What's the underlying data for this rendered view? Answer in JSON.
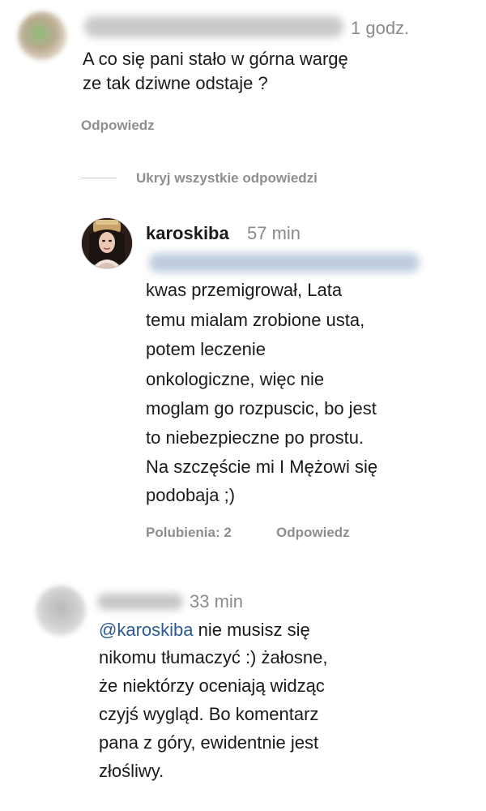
{
  "comments": [
    {
      "time": "1 godz.",
      "text_lines": [
        "A co się pani stało w górna wargę",
        "ze tak dziwne odstaje ?"
      ],
      "reply_label": "Odpowiedz"
    },
    {
      "hide_replies_label": "Ukryj wszystkie odpowiedzi"
    },
    {
      "username": "karoskiba",
      "time": "57 min",
      "text_lines": [
        "kwas przemigrował, Lata",
        "temu mialam zrobione usta,",
        "potem leczenie",
        "onkologiczne, więc nie",
        "moglam go rozpuscic, bo jest",
        "to niebezpieczne po prostu.",
        "Na szczęście mi I Mężowi się",
        "podobaja ;)"
      ],
      "likes_label": "Polubienia: 2",
      "reply_label": "Odpowiedz"
    },
    {
      "time": "33 min",
      "mention": "@karoskiba",
      "first_line_rest": " nie musisz się",
      "text_lines": [
        "nikomu tłumaczyć :) żałosne,",
        "że niektórzy oceniają widząc",
        "czyjś wygląd. Bo komentarz",
        "pana z góry, ewidentnie jest",
        "złośliwy."
      ]
    }
  ]
}
